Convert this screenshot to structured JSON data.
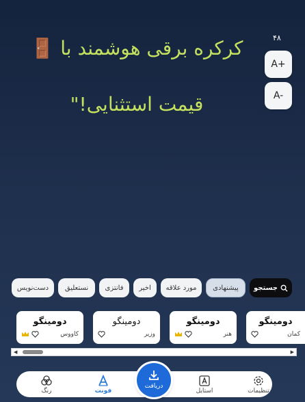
{
  "preview": {
    "line1": "کرکره برقی هوشمند با",
    "line2": "قیمت استثنایی!\"",
    "emoji": "🚪"
  },
  "size_controls": {
    "value": "۴۸",
    "increase_label": "A+",
    "decrease_label": "A-"
  },
  "categories": {
    "search_label": "جستجو",
    "items": [
      {
        "label": "پیشنهادی",
        "active": true
      },
      {
        "label": "مورد علاقه"
      },
      {
        "label": "اخیر"
      },
      {
        "label": "فانتزی"
      },
      {
        "label": "نستعلیق"
      },
      {
        "label": "دست‌نویس"
      }
    ]
  },
  "fonts": [
    {
      "sample": "دومینگو",
      "name": "کمان",
      "premium": false,
      "favorite": false
    },
    {
      "sample": "دومینگو",
      "name": "هنر",
      "premium": true,
      "favorite": false
    },
    {
      "sample": "دومینگو",
      "name": "وزیر",
      "premium": false,
      "favorite": false
    },
    {
      "sample": "دومینگو",
      "name": "کاووس",
      "premium": true,
      "favorite": false
    }
  ],
  "nav": {
    "settings": "تنظیمات",
    "style": "استایل",
    "download": "دریافت",
    "font": "فونت",
    "color": "رنگ"
  },
  "colors": {
    "preview_text": "#c3e05f",
    "accent": "#1e6ad8",
    "premium_crown": "#e7b400"
  }
}
